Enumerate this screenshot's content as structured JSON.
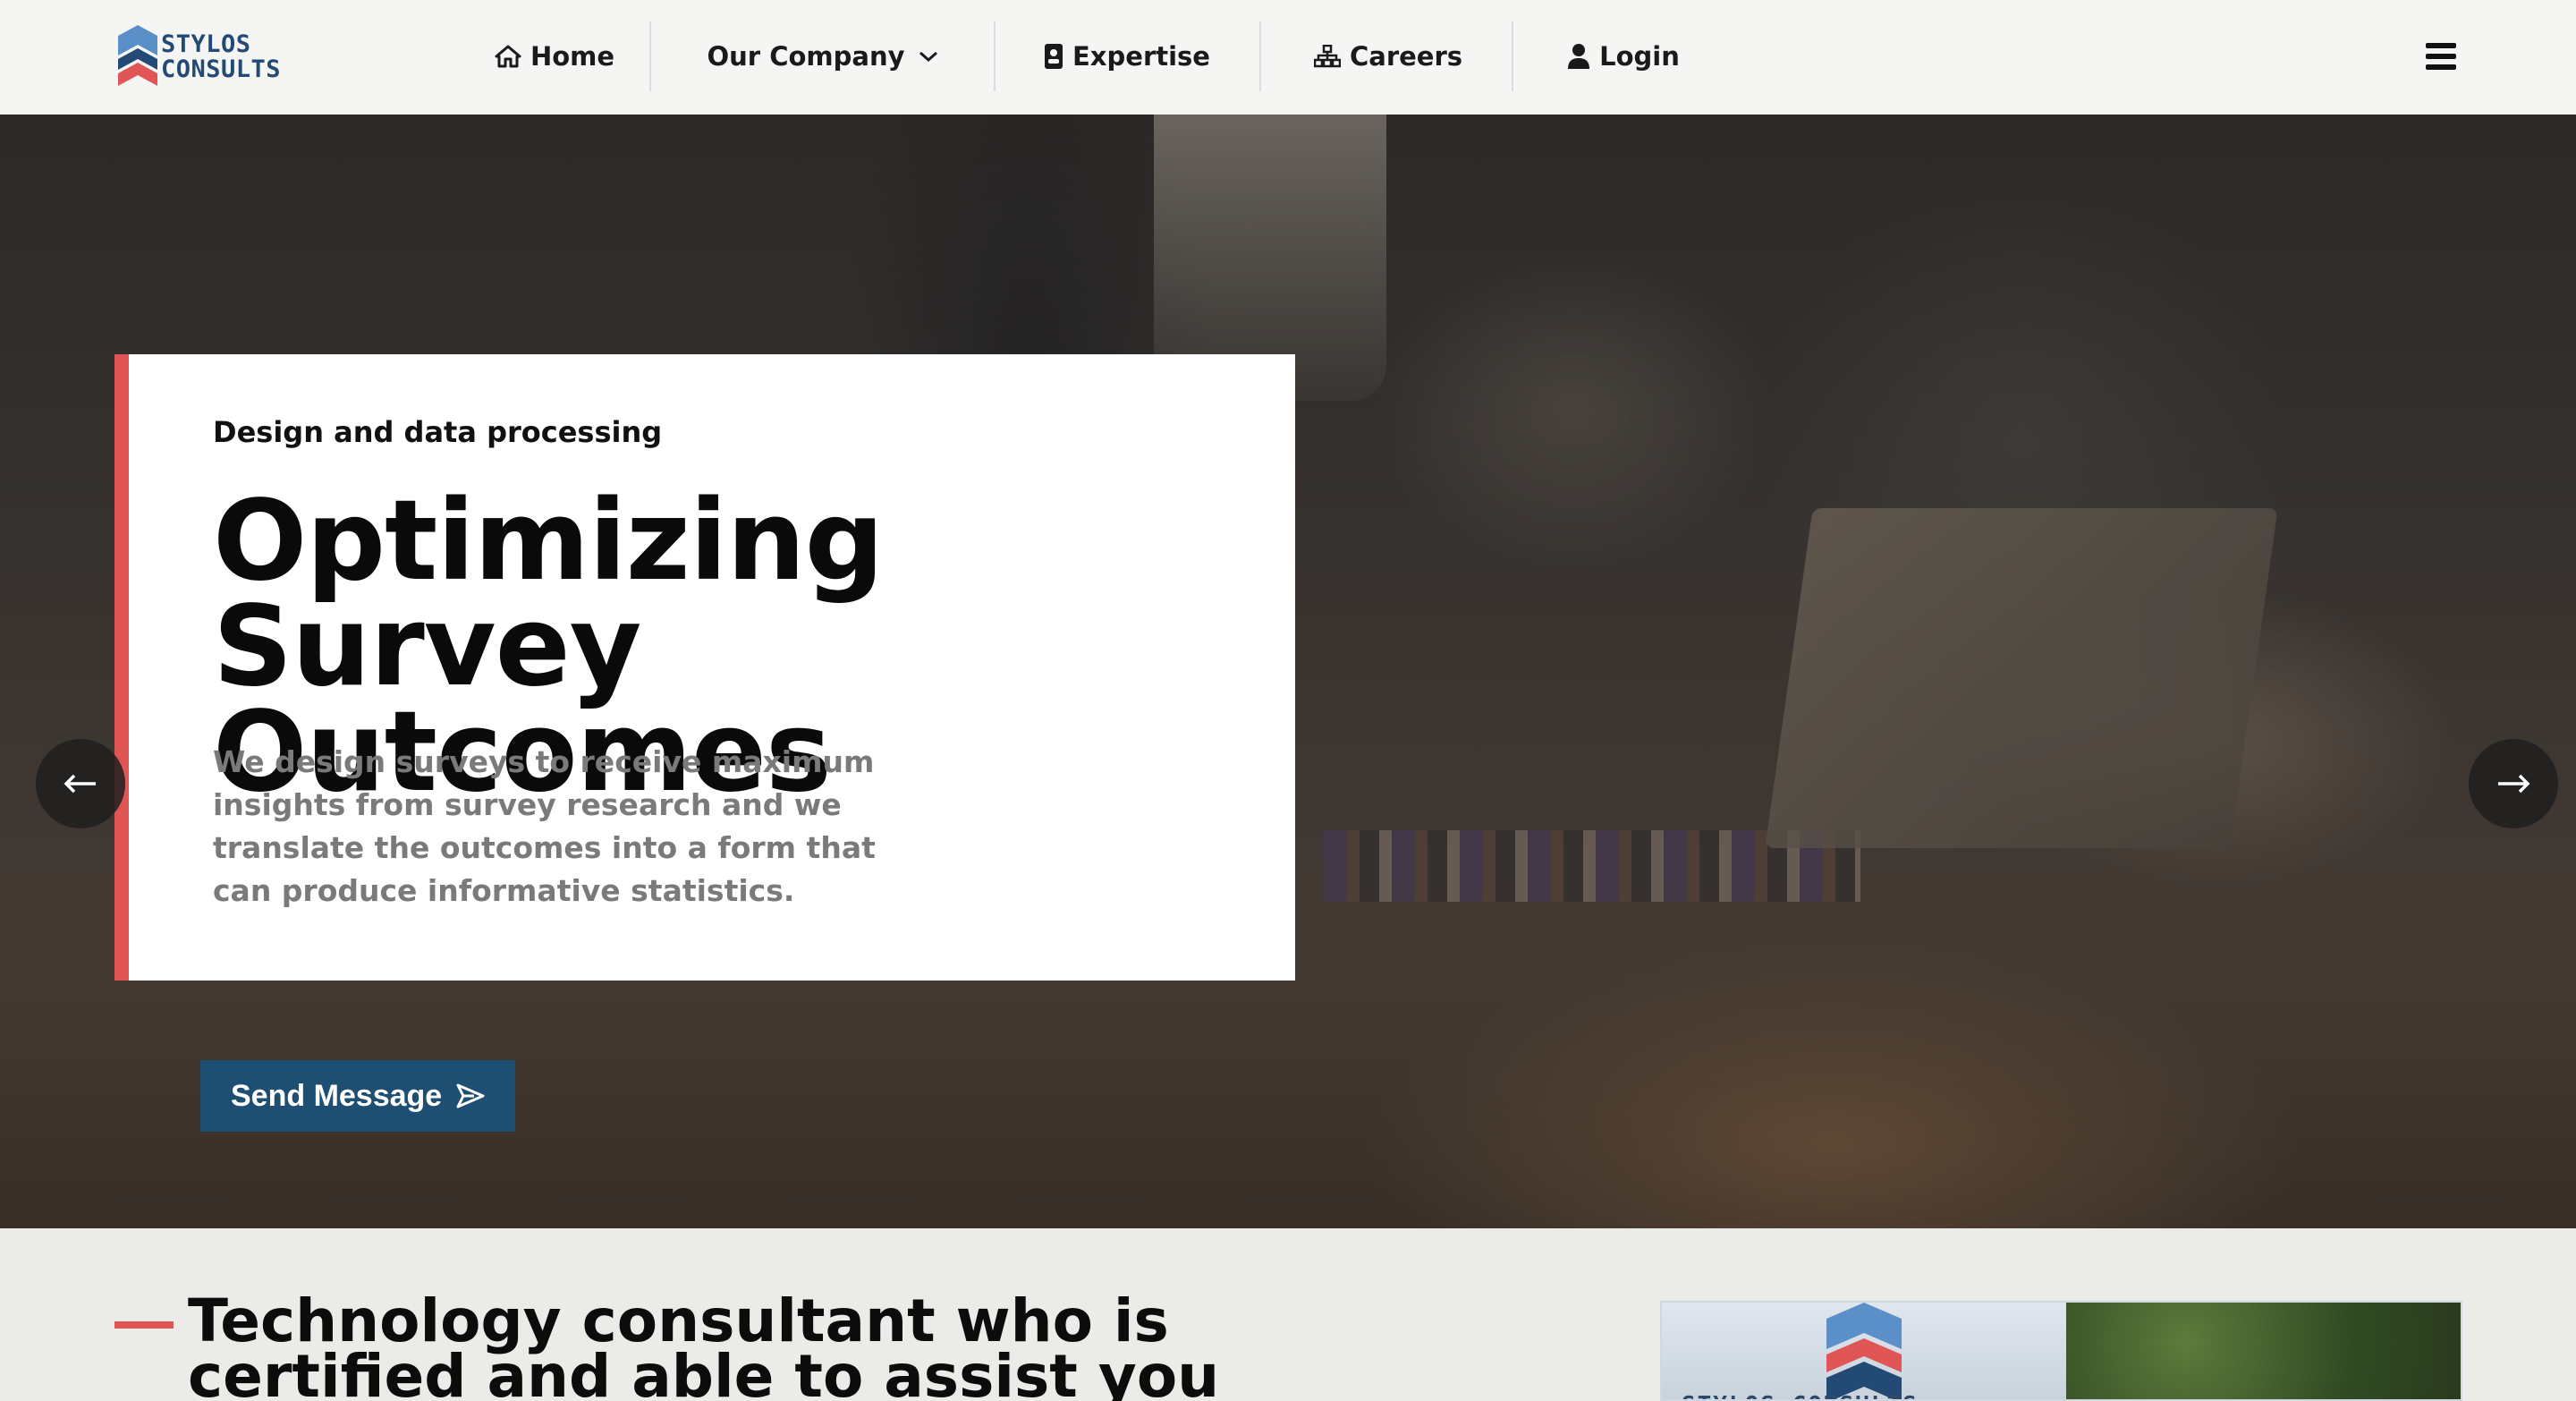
{
  "brand": {
    "name_line1": "STYLOS",
    "name_line2": "CONSULTS",
    "colors": {
      "navy": "#234a74",
      "red": "#e05656",
      "sky": "#5b8fc8"
    }
  },
  "nav": {
    "items": [
      {
        "label": "Home",
        "icon": "home-icon"
      },
      {
        "label": "Our Company",
        "icon": "chevron-down-icon"
      },
      {
        "label": "Expertise",
        "icon": "id-badge-icon"
      },
      {
        "label": "Careers",
        "icon": "sitemap-icon"
      },
      {
        "label": "Login",
        "icon": "user-icon"
      }
    ],
    "menu_icon": "hamburger-icon"
  },
  "hero": {
    "kicker": "Design and data processing",
    "title": "Optimizing Survey Outcomes",
    "description": "We design surveys to receive maximum insights from survey research and we translate the outcomes into a form that can produce informative statistics.",
    "cta_label": "Send Message",
    "cta_icon": "send-icon",
    "prev_icon": "arrow-left-icon",
    "next_icon": "arrow-right-icon",
    "slides": {
      "count": 3,
      "active": 2
    },
    "accent": "#e05656",
    "button_color": "#1e4e72"
  },
  "about": {
    "title": "Technology consultant who is certified and able to assist you",
    "image_sign_text": "STYLOS CONSULTS"
  }
}
